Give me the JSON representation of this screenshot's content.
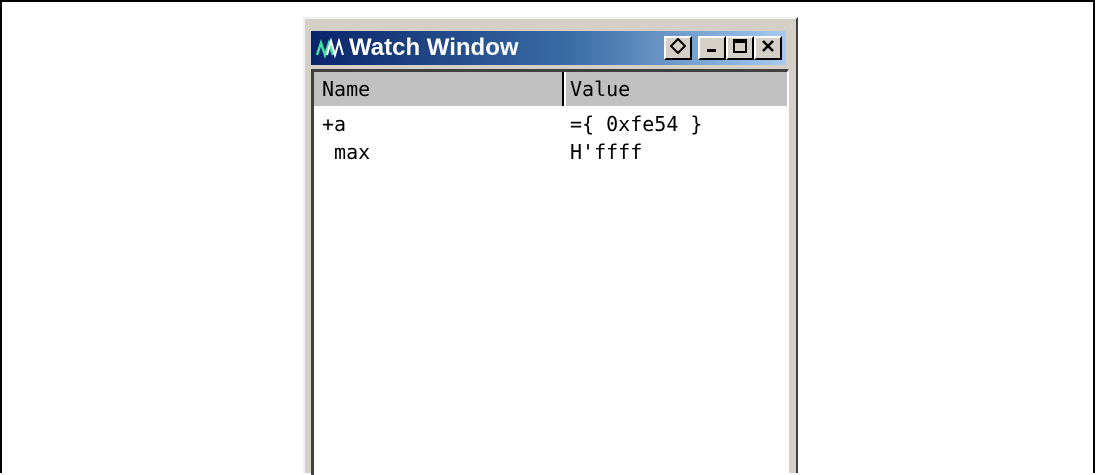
{
  "window": {
    "title": "Watch Window"
  },
  "table": {
    "columns": [
      "Name",
      "Value"
    ],
    "rows": [
      {
        "name": "+a",
        "value": "={ 0xfe54 }"
      },
      {
        "name": " max",
        "value": "H'ffff"
      }
    ]
  },
  "icons": {
    "app": "waveform-icon",
    "buttons": [
      "restore-icon",
      "minimize-icon",
      "maximize-icon",
      "close-icon"
    ]
  },
  "colors": {
    "titlebar_start": "#0a246a",
    "titlebar_end": "#a6caf0",
    "header_bg": "#c0c0c0",
    "chrome": "#d4d0c8"
  }
}
